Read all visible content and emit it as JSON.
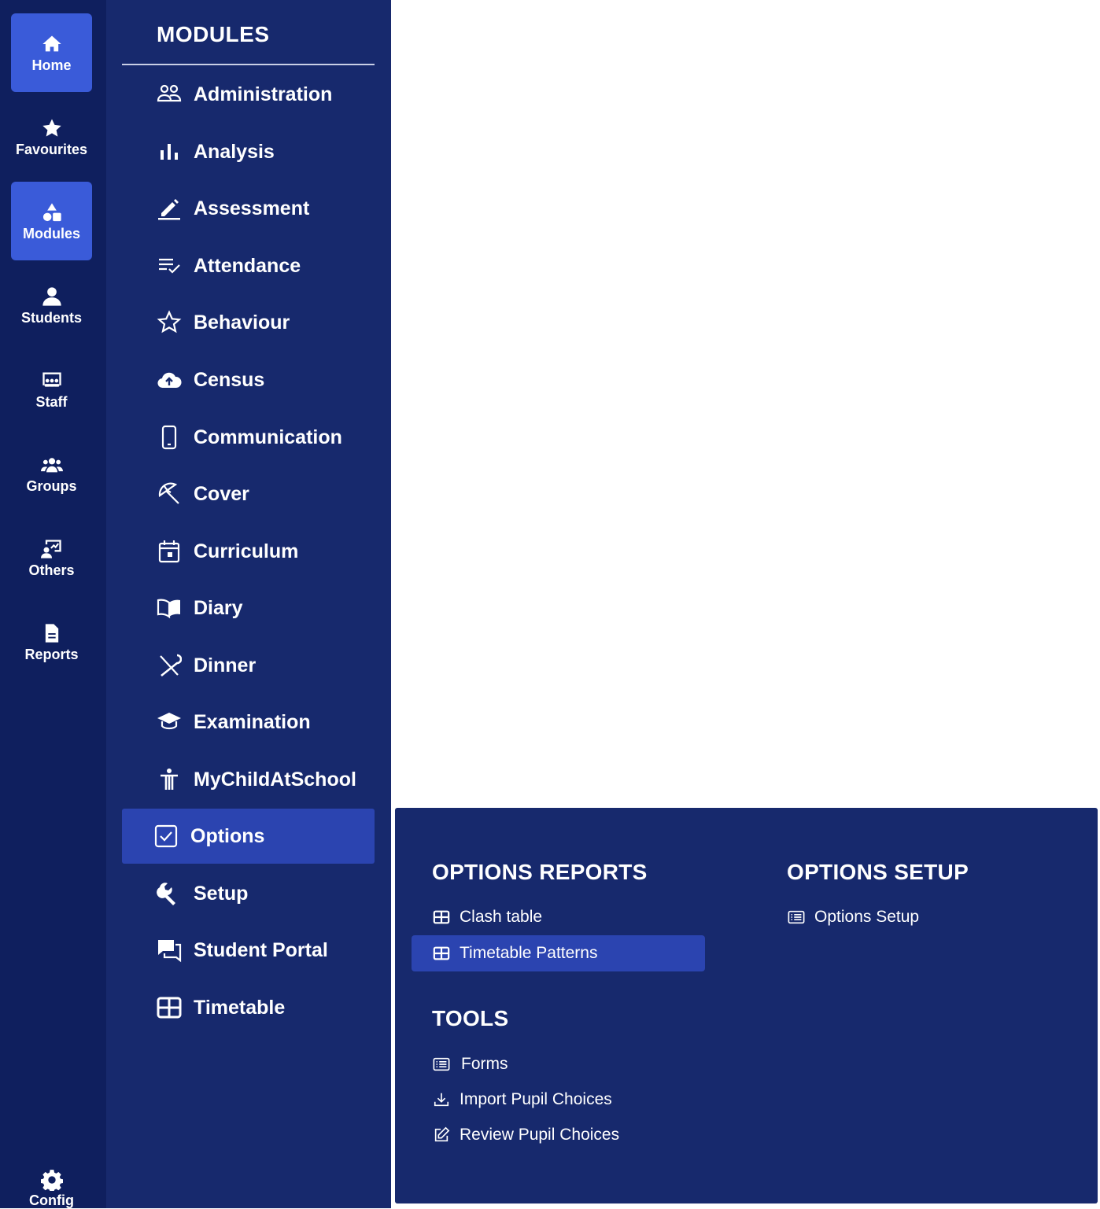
{
  "rail": {
    "items": [
      {
        "label": "Home",
        "icon": "home-icon"
      },
      {
        "label": "Favourites",
        "icon": "star-icon"
      },
      {
        "label": "Modules",
        "icon": "shapes-icon"
      },
      {
        "label": "Students",
        "icon": "person-icon"
      },
      {
        "label": "Staff",
        "icon": "staff-board-icon"
      },
      {
        "label": "Groups",
        "icon": "groups-icon"
      },
      {
        "label": "Others",
        "icon": "others-icon"
      },
      {
        "label": "Reports",
        "icon": "document-icon"
      }
    ],
    "config_label": "Config"
  },
  "modules": {
    "title": "MODULES",
    "items": [
      {
        "label": "Administration",
        "icon": "people-outline-icon"
      },
      {
        "label": "Analysis",
        "icon": "bar-chart-icon"
      },
      {
        "label": "Assessment",
        "icon": "pencil-icon"
      },
      {
        "label": "Attendance",
        "icon": "list-check-icon"
      },
      {
        "label": "Behaviour",
        "icon": "star-outline-icon"
      },
      {
        "label": "Census",
        "icon": "cloud-upload-icon"
      },
      {
        "label": "Communication",
        "icon": "phone-icon"
      },
      {
        "label": "Cover",
        "icon": "beach-umbrella-icon"
      },
      {
        "label": "Curriculum",
        "icon": "calendar-icon"
      },
      {
        "label": "Diary",
        "icon": "book-open-icon"
      },
      {
        "label": "Dinner",
        "icon": "cutlery-icon"
      },
      {
        "label": "Examination",
        "icon": "graduation-cap-icon"
      },
      {
        "label": "MyChildAtSchool",
        "icon": "accessibility-icon"
      },
      {
        "label": "Options",
        "icon": "checkbox-icon"
      },
      {
        "label": "Setup",
        "icon": "wrench-icon"
      },
      {
        "label": "Student Portal",
        "icon": "chat-icon"
      },
      {
        "label": "Timetable",
        "icon": "table-icon"
      }
    ],
    "active": "Options"
  },
  "panel": {
    "reports_title": "OPTIONS REPORTS",
    "reports": [
      {
        "label": "Clash table",
        "icon": "table-small-icon"
      },
      {
        "label": "Timetable Patterns",
        "icon": "table-small-icon"
      }
    ],
    "setup_title": "OPTIONS SETUP",
    "setup": [
      {
        "label": "Options Setup",
        "icon": "list-box-icon"
      }
    ],
    "tools_title": "TOOLS",
    "tools": [
      {
        "label": "Forms",
        "icon": "list-box-icon"
      },
      {
        "label": "Import Pupil Choices",
        "icon": "download-icon"
      },
      {
        "label": "Review Pupil Choices",
        "icon": "edit-icon"
      }
    ]
  },
  "colors": {
    "rail_bg": "#0f1f5e",
    "modules_bg": "#17296d",
    "active_rail": "#3a5bd9",
    "active_item": "#2b44b0"
  }
}
